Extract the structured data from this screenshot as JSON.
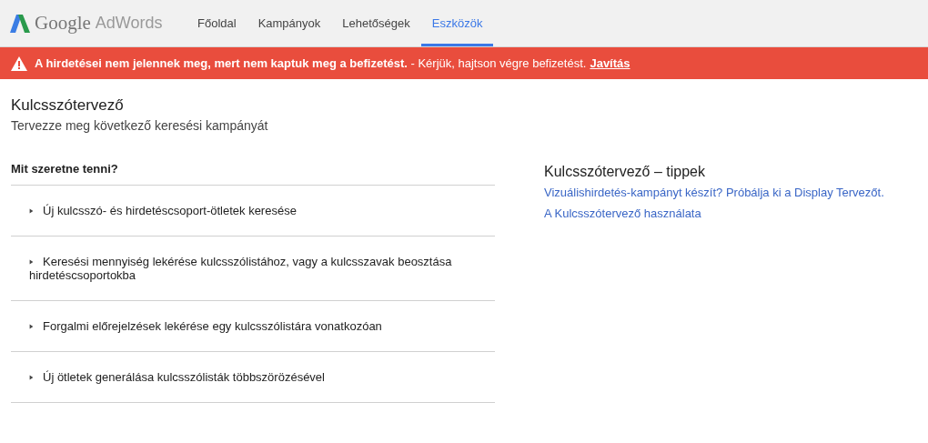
{
  "header": {
    "logo": {
      "brand": "Google",
      "product": "AdWords"
    },
    "nav": [
      {
        "label": "Főoldal",
        "selected": false
      },
      {
        "label": "Kampányok",
        "selected": false
      },
      {
        "label": "Lehetőségek",
        "selected": false
      },
      {
        "label": "Eszközök",
        "selected": true
      }
    ]
  },
  "alert": {
    "message": "**A hirdetései nem jelennek meg, mert nem kaptuk meg a befizetést.** - Kérjük, hajtson végre befizetést.",
    "link": "Javítás"
  },
  "page": {
    "title": "Kulcsszótervező",
    "subtitle": "Tervezze meg következő keresési kampányát"
  },
  "options": {
    "heading": "Mit szeretne tenni?",
    "items": [
      {
        "label": "Új kulcsszó- és hirdetéscsoport-ötletek keresése",
        "expanded": false
      },
      {
        "label": "Keresési mennyiség lekérése kulcsszólistához, vagy a kulcsszavak beosztása hirdetéscsoportokba",
        "expanded": false
      },
      {
        "label": "Forgalmi előrejelzések lekérése egy kulcsszólistára vonatkozóan",
        "expanded": false
      },
      {
        "label": "Új ötletek generálása kulcsszólisták többszörözésével",
        "expanded": false
      }
    ]
  },
  "tips": {
    "title": "Kulcsszótervező – tippek",
    "links": [
      "Vizuálishirdetés-kampányt készít? Próbálja ki a Display Tervezőt.",
      "A Kulcsszótervező használata"
    ]
  }
}
